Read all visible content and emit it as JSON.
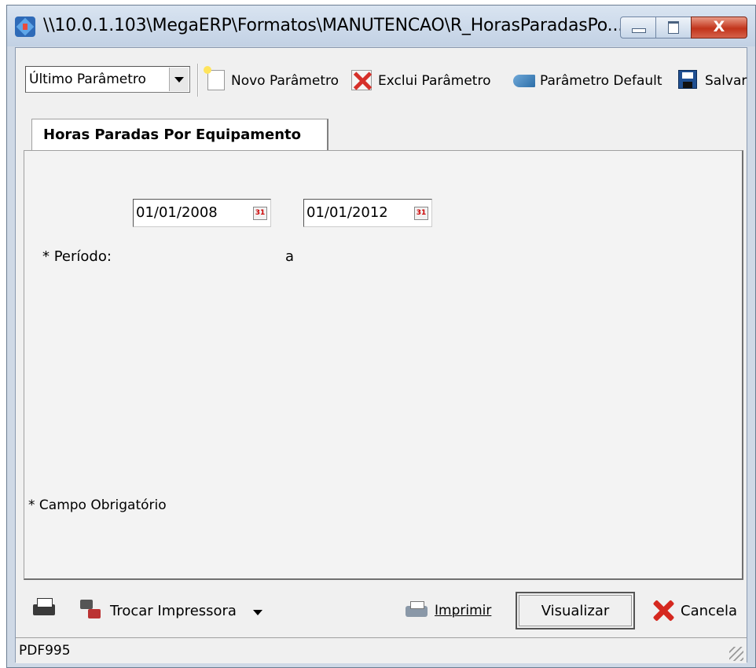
{
  "window": {
    "title": "\\\\10.0.1.103\\MegaERP\\Formatos\\MANUTENCAO\\R_HorasParadasPo...",
    "close_glyph": "X",
    "accent_color": "#c2341b"
  },
  "toolbar": {
    "param_select_value": "Último Parâmetro",
    "novo_label": "Novo Parâmetro",
    "exclui_label": "Exclui Parâmetro",
    "default_label": "Parâmetro Default",
    "salvar_label": "Salvar"
  },
  "tabs": [
    {
      "label": "Horas Paradas Por Equipamento",
      "active": true
    }
  ],
  "form": {
    "periodo_label": "* Período:",
    "date_from": "01/01/2008",
    "separator": "a",
    "date_to": "01/01/2012",
    "calendar_glyph": "31",
    "required_note": "* Campo Obrigatório"
  },
  "footer": {
    "trocar_label": "Trocar Impressora",
    "imprimir_label": "Imprimir",
    "visualizar_label": "Visualizar",
    "cancela_label": "Cancela"
  },
  "status": {
    "printer_name": "PDF995"
  },
  "icons": [
    "app-icon",
    "new-document-icon",
    "delete-icon",
    "default-arrow-icon",
    "save-icon",
    "calendar-icon",
    "printer-settings-icon",
    "swap-printer-icon",
    "printer-icon",
    "cancel-x-icon",
    "resize-grip-icon"
  ]
}
